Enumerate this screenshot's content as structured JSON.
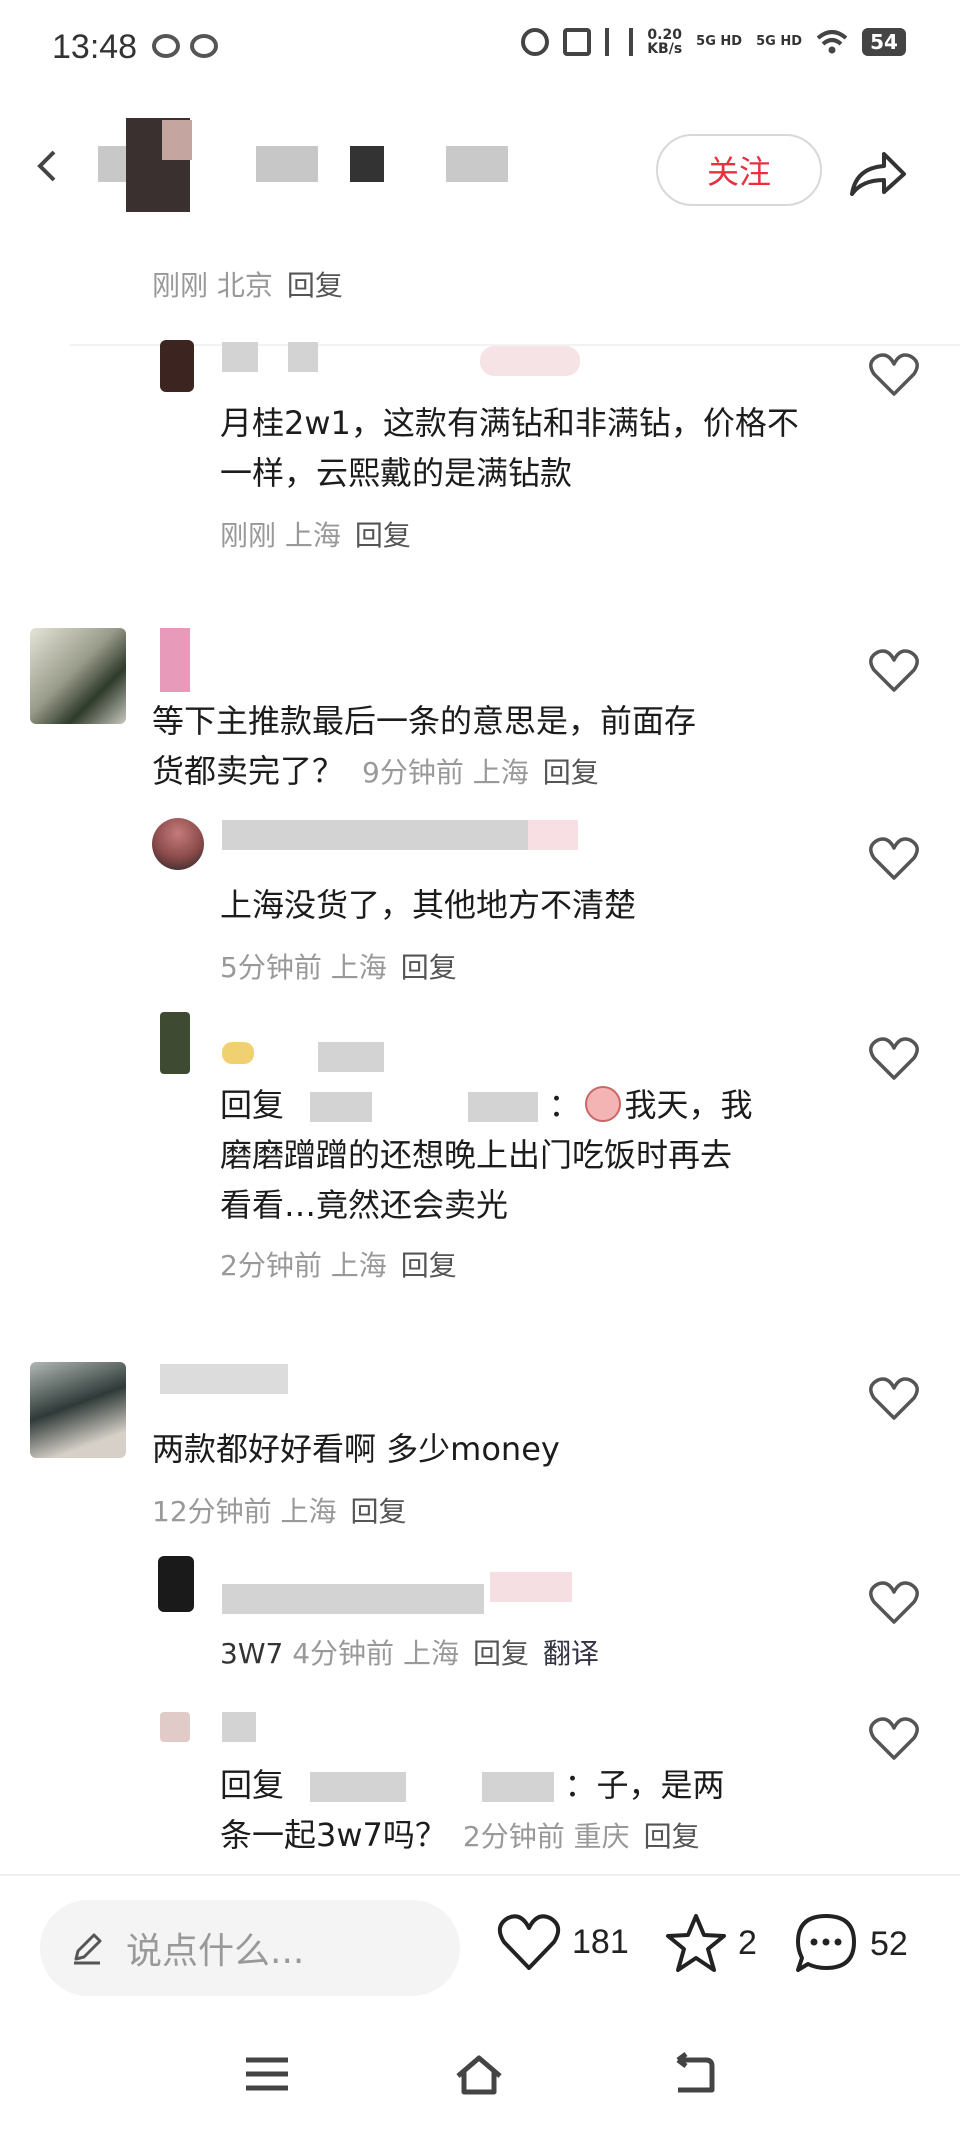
{
  "status_bar": {
    "time": "13:48",
    "net_speed": "0.20\nKB/s",
    "signal1": "5G HD",
    "signal2": "5G HD",
    "battery": "54"
  },
  "header": {
    "follow_label": "关注"
  },
  "comments": [
    {
      "meta": "刚刚 北京",
      "reply": "回复"
    },
    {
      "text": "月桂2w1，这款有满钻和非满钻，价格不一样，云熙戴的是满钻款",
      "meta": "刚刚 上海",
      "reply": "回复"
    },
    {
      "text_line1": "等下主推款最后一条的意思是，前面存",
      "text_line2": "货都卖完了？",
      "meta": "9分钟前 上海",
      "reply": "回复"
    },
    {
      "text": "上海没货了，其他地方不清楚",
      "meta": "5分钟前 上海",
      "reply": "回复"
    },
    {
      "prefix": "回复",
      "colon": "：",
      "line1_tail": "我天，我",
      "line2": "磨磨蹭蹭的还想晚上出门吃饭时再去",
      "line3": "看看…竟然还会卖光",
      "meta": "2分钟前 上海",
      "reply": "回复"
    },
    {
      "text": "两款都好好看啊 多少money",
      "meta": "12分钟前 上海",
      "reply": "回复"
    },
    {
      "text_partial": "3W7",
      "meta": "4分钟前 上海",
      "reply": "回复",
      "translate": "翻译"
    },
    {
      "prefix": "回复",
      "colon": "：",
      "line1_tail": "子，是两",
      "line2": "条一起3w7吗？",
      "meta": "2分钟前 重庆",
      "reply": "回复"
    }
  ],
  "bottom_bar": {
    "input_placeholder": "说点什么...",
    "likes": "181",
    "stars": "2",
    "comments": "52"
  },
  "icons": {
    "back": "back-icon",
    "share": "share-icon",
    "like": "heart-icon",
    "star": "star-icon",
    "comment": "comment-bubble-icon",
    "pen": "pen-icon"
  }
}
